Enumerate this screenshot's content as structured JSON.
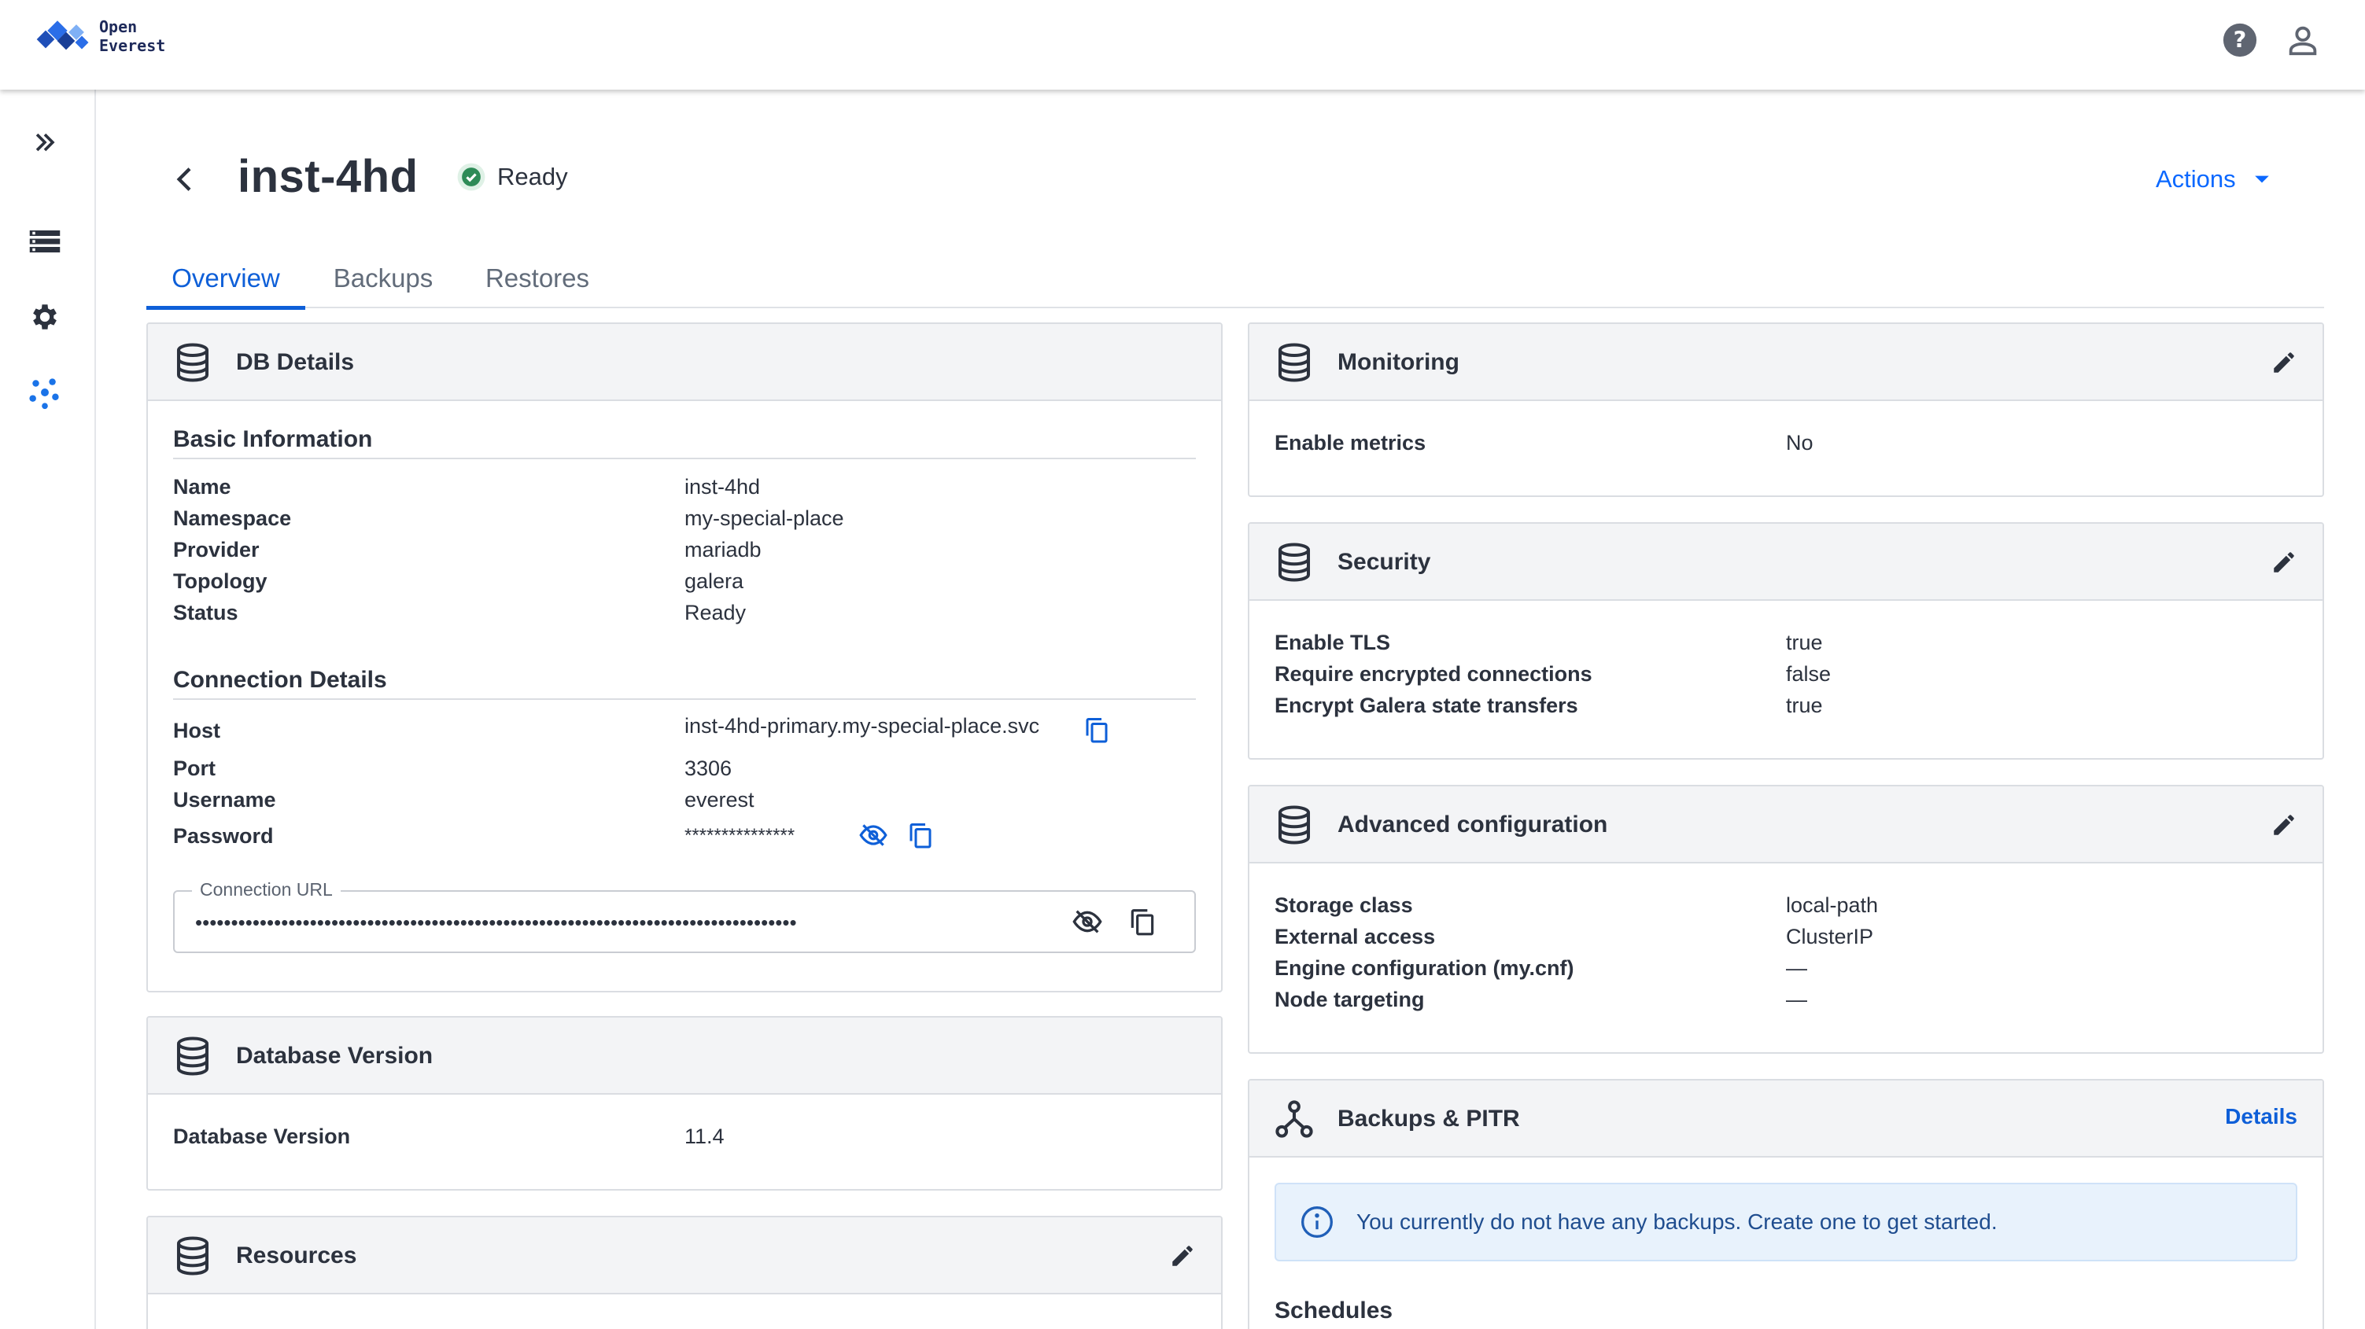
{
  "app": {
    "logo_line1": "Open",
    "logo_line2": "Everest"
  },
  "header": {
    "title": "inst-4hd",
    "status": "Ready",
    "actions_label": "Actions"
  },
  "tabs": [
    {
      "label": "Overview",
      "active": true
    },
    {
      "label": "Backups",
      "active": false
    },
    {
      "label": "Restores",
      "active": false
    }
  ],
  "db_details": {
    "title": "DB Details",
    "basic_title": "Basic Information",
    "basic": [
      {
        "label": "Name",
        "value": "inst-4hd"
      },
      {
        "label": "Namespace",
        "value": "my-special-place"
      },
      {
        "label": "Provider",
        "value": "mariadb"
      },
      {
        "label": "Topology",
        "value": "galera"
      },
      {
        "label": "Status",
        "value": "Ready"
      }
    ],
    "connection_title": "Connection Details",
    "connection": [
      {
        "label": "Host",
        "value": "inst-4hd-primary.my-special-place.svc"
      },
      {
        "label": "Port",
        "value": "3306"
      },
      {
        "label": "Username",
        "value": "everest"
      },
      {
        "label": "Password",
        "value": "***************"
      }
    ],
    "connection_url_label": "Connection URL",
    "connection_url_value": "••••••••••••••••••••••••••••••••••••••••••••••••••••••••••••••••••••••••••••••••••••"
  },
  "database_version": {
    "title": "Database Version",
    "label": "Database Version",
    "value": "11.4"
  },
  "resources": {
    "title": "Resources"
  },
  "monitoring": {
    "title": "Monitoring",
    "label": "Enable metrics",
    "value": "No"
  },
  "security": {
    "title": "Security",
    "rows": [
      {
        "label": "Enable TLS",
        "value": "true"
      },
      {
        "label": "Require encrypted connections",
        "value": "false"
      },
      {
        "label": "Encrypt Galera state transfers",
        "value": "true"
      }
    ]
  },
  "advanced": {
    "title": "Advanced configuration",
    "rows": [
      {
        "label": "Storage class",
        "value": "local-path"
      },
      {
        "label": "External access",
        "value": "ClusterIP"
      },
      {
        "label": "Engine configuration (my.cnf)",
        "value": "—"
      },
      {
        "label": "Node targeting",
        "value": "—"
      }
    ]
  },
  "backups_pitr": {
    "title": "Backups & PITR",
    "details_label": "Details",
    "alert_text": "You currently do not have any backups. Create one to get started.",
    "schedules_title": "Schedules"
  },
  "colors": {
    "accent": "#0e5fd8",
    "status_ok": "#2e8b57",
    "card_header_bg": "#f3f4f6"
  },
  "icons": {
    "nav": [
      "expand-chevrons-icon",
      "database-list-icon",
      "gear-icon",
      "cluster-dots-icon"
    ],
    "header": [
      "help-icon",
      "user-icon"
    ]
  }
}
